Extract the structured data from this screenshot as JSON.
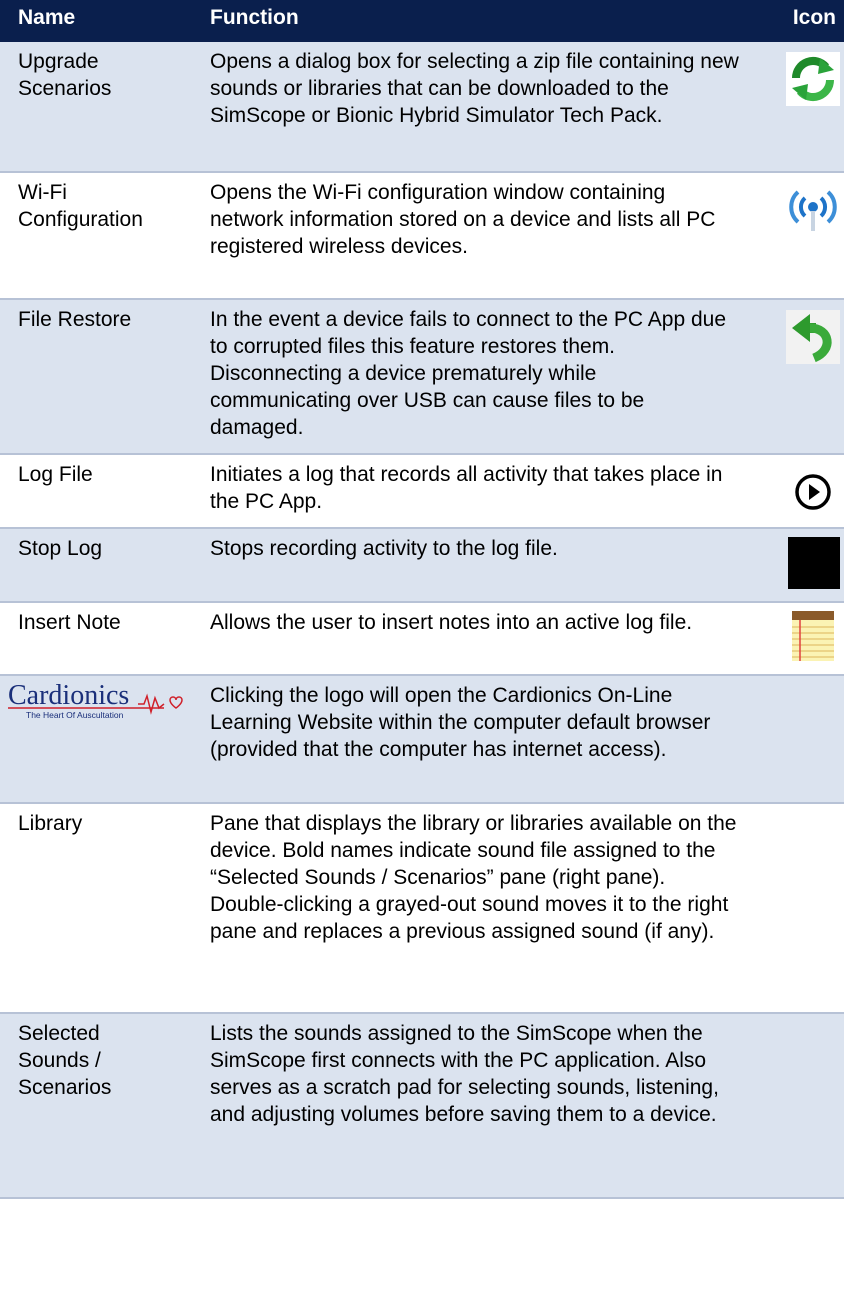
{
  "header": {
    "name": "Name",
    "function": "Function",
    "icon": "Icon"
  },
  "rows": [
    {
      "name": "Upgrade\nScenarios",
      "function": "Opens a dialog box for selecting a zip file containing new sounds or libraries that can be downloaded to the SimScope or Bionic Hybrid Simulator Tech Pack.",
      "icon": "refresh-icon"
    },
    {
      "name": "Wi-Fi\nConfiguration",
      "function": "Opens the Wi-Fi configuration window containing network information stored on a device and lists all PC registered wireless devices.",
      "icon": "wifi-broadcast-icon"
    },
    {
      "name": "File Restore",
      "function": "In the event a device fails to connect to the PC App due to corrupted files this feature restores them.  Disconnecting a device prematurely while communicating over USB can cause files to be damaged.",
      "icon": "undo-arrow-icon"
    },
    {
      "name": "Log File",
      "function": "Initiates a log that records all activity that takes place in the PC App.",
      "icon": "play-circle-icon"
    },
    {
      "name": "Stop Log",
      "function": "Stops recording activity to the log file.",
      "icon": "stop-square-icon"
    },
    {
      "name": "Insert Note",
      "function": "Allows the user to insert notes into an active log file.",
      "icon": "notepad-icon"
    },
    {
      "name": "",
      "logo_text": "Cardionics",
      "logo_tagline": "The Heart Of Auscultation",
      "function": "Clicking the logo will open the Cardionics On-Line Learning Website within the computer default browser (provided that the computer has internet access).",
      "icon": ""
    },
    {
      "name": "Library",
      "function": "Pane that displays the library or libraries available on the device.  Bold names indicate sound file assigned to the “Selected Sounds / Scenarios” pane (right pane).  Double-clicking a grayed-out sound moves it to the right pane and replaces a previous assigned sound (if any).",
      "icon": ""
    },
    {
      "name": "Selected\nSounds /\nScenarios",
      "function": "Lists the sounds assigned to the SimScope when the SimScope first connects with the PC application.  Also serves as a scratch pad for selecting sounds, listening, and adjusting volumes before saving them to a device.",
      "icon": ""
    }
  ],
  "colors": {
    "header_bg": "#0a1f4d",
    "shaded_row": "#dbe3ef",
    "logo_blue": "#1a2f7a",
    "logo_red": "#d0202a"
  }
}
